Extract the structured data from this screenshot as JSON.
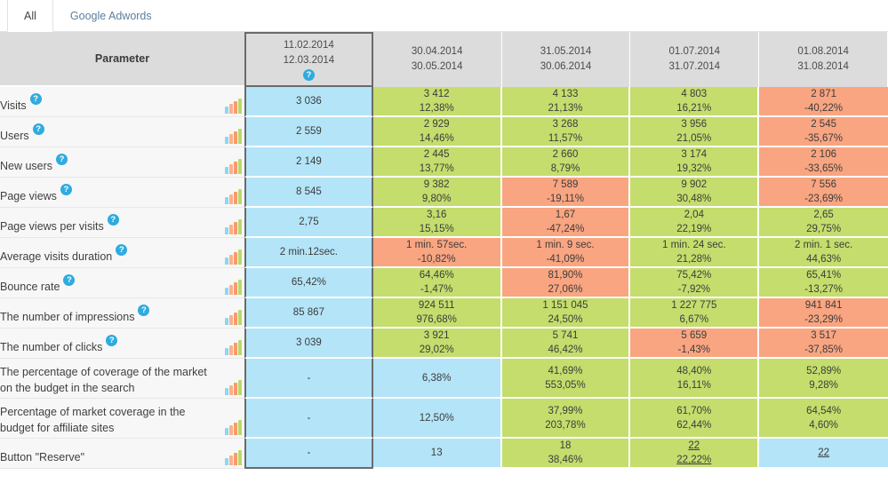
{
  "tabs": [
    {
      "label": "All",
      "active": true
    },
    {
      "label": "Google Adwords",
      "active": false
    }
  ],
  "colors": {
    "blue": "#b4e4f7",
    "green": "#c4dd6d",
    "orange": "#f9a581",
    "header_gray": "#dcdcdc",
    "badge_blue": "#2fabdf",
    "baseline_border": "#6a6a6a"
  },
  "table": {
    "param_header": "Parameter",
    "param_header_icon": "question-mark-icon",
    "columns": [
      {
        "from": "11.02.2014",
        "to": "12.03.2014",
        "baseline": true,
        "has_help": true
      },
      {
        "from": "30.04.2014",
        "to": "30.05.2014",
        "baseline": false,
        "has_help": false
      },
      {
        "from": "31.05.2014",
        "to": "30.06.2014",
        "baseline": false,
        "has_help": false
      },
      {
        "from": "01.07.2014",
        "to": "31.07.2014",
        "baseline": false,
        "has_help": false
      },
      {
        "from": "01.08.2014",
        "to": "31.08.2014",
        "baseline": false,
        "has_help": false
      }
    ],
    "rows": [
      {
        "label": "Visits",
        "has_help": true,
        "cells": [
          {
            "value": "3 036",
            "pct": "",
            "color": "blue"
          },
          {
            "value": "3 412",
            "pct": "12,38%",
            "color": "green"
          },
          {
            "value": "4 133",
            "pct": "21,13%",
            "color": "green"
          },
          {
            "value": "4 803",
            "pct": "16,21%",
            "color": "green"
          },
          {
            "value": "2 871",
            "pct": "-40,22%",
            "color": "orange"
          }
        ]
      },
      {
        "label": "Users",
        "has_help": true,
        "cells": [
          {
            "value": "2 559",
            "pct": "",
            "color": "blue"
          },
          {
            "value": "2 929",
            "pct": "14,46%",
            "color": "green"
          },
          {
            "value": "3 268",
            "pct": "11,57%",
            "color": "green"
          },
          {
            "value": "3 956",
            "pct": "21,05%",
            "color": "green"
          },
          {
            "value": "2 545",
            "pct": "-35,67%",
            "color": "orange"
          }
        ]
      },
      {
        "label": "New users",
        "has_help": true,
        "cells": [
          {
            "value": "2 149",
            "pct": "",
            "color": "blue"
          },
          {
            "value": "2 445",
            "pct": "13,77%",
            "color": "green"
          },
          {
            "value": "2 660",
            "pct": "8,79%",
            "color": "green"
          },
          {
            "value": "3 174",
            "pct": "19,32%",
            "color": "green"
          },
          {
            "value": "2 106",
            "pct": "-33,65%",
            "color": "orange"
          }
        ]
      },
      {
        "label": "Page views",
        "has_help": true,
        "cells": [
          {
            "value": "8 545",
            "pct": "",
            "color": "blue"
          },
          {
            "value": "9 382",
            "pct": "9,80%",
            "color": "green"
          },
          {
            "value": "7 589",
            "pct": "-19,11%",
            "color": "orange"
          },
          {
            "value": "9 902",
            "pct": "30,48%",
            "color": "green"
          },
          {
            "value": "7 556",
            "pct": "-23,69%",
            "color": "orange"
          }
        ]
      },
      {
        "label": "Page views per visits",
        "has_help": true,
        "cells": [
          {
            "value": "2,75",
            "pct": "",
            "color": "blue"
          },
          {
            "value": "3,16",
            "pct": "15,15%",
            "color": "green"
          },
          {
            "value": "1,67",
            "pct": "-47,24%",
            "color": "orange"
          },
          {
            "value": "2,04",
            "pct": "22,19%",
            "color": "green"
          },
          {
            "value": "2,65",
            "pct": "29,75%",
            "color": "green"
          }
        ]
      },
      {
        "label": "Average visits duration",
        "has_help": true,
        "cells": [
          {
            "value": "2 min.12sec.",
            "pct": "",
            "color": "blue"
          },
          {
            "value": "1 min. 57sec.",
            "pct": "-10,82%",
            "color": "orange"
          },
          {
            "value": "1 min. 9 sec.",
            "pct": "-41,09%",
            "color": "orange"
          },
          {
            "value": "1 min. 24 sec.",
            "pct": "21,28%",
            "color": "green"
          },
          {
            "value": "2 min. 1 sec.",
            "pct": "44,63%",
            "color": "green"
          }
        ]
      },
      {
        "label": "Bounce rate",
        "has_help": true,
        "cells": [
          {
            "value": "65,42%",
            "pct": "",
            "color": "blue"
          },
          {
            "value": "64,46%",
            "pct": "-1,47%",
            "color": "green"
          },
          {
            "value": "81,90%",
            "pct": "27,06%",
            "color": "orange"
          },
          {
            "value": "75,42%",
            "pct": "-7,92%",
            "color": "green"
          },
          {
            "value": "65,41%",
            "pct": "-13,27%",
            "color": "green"
          }
        ]
      },
      {
        "label": "The number of impressions",
        "has_help": true,
        "cells": [
          {
            "value": "85 867",
            "pct": "",
            "color": "blue"
          },
          {
            "value": "924 511",
            "pct": "976,68%",
            "color": "green"
          },
          {
            "value": "1 151 045",
            "pct": "24,50%",
            "color": "green"
          },
          {
            "value": "1 227 775",
            "pct": "6,67%",
            "color": "green"
          },
          {
            "value": "941 841",
            "pct": "-23,29%",
            "color": "orange"
          }
        ]
      },
      {
        "label": "The number of clicks",
        "has_help": true,
        "cells": [
          {
            "value": "3 039",
            "pct": "",
            "color": "blue"
          },
          {
            "value": "3 921",
            "pct": "29,02%",
            "color": "green"
          },
          {
            "value": "5 741",
            "pct": "46,42%",
            "color": "green"
          },
          {
            "value": "5 659",
            "pct": "-1,43%",
            "color": "orange"
          },
          {
            "value": "3 517",
            "pct": "-37,85%",
            "color": "orange"
          }
        ]
      },
      {
        "label": "The percentage of coverage of the market on the budget in the search",
        "has_help": false,
        "cells": [
          {
            "value": "-",
            "pct": "",
            "color": "blue"
          },
          {
            "value": "6,38%",
            "pct": "",
            "color": "blue"
          },
          {
            "value": "41,69%",
            "pct": "553,05%",
            "color": "green"
          },
          {
            "value": "48,40%",
            "pct": "16,11%",
            "color": "green"
          },
          {
            "value": "52,89%",
            "pct": "9,28%",
            "color": "green"
          }
        ]
      },
      {
        "label": "Percentage of market coverage in the budget for affiliate sites",
        "has_help": false,
        "cells": [
          {
            "value": "-",
            "pct": "",
            "color": "blue"
          },
          {
            "value": "12,50%",
            "pct": "",
            "color": "blue"
          },
          {
            "value": "37,99%",
            "pct": "203,78%",
            "color": "green"
          },
          {
            "value": "61,70%",
            "pct": "62,44%",
            "color": "green"
          },
          {
            "value": "64,54%",
            "pct": "4,60%",
            "color": "green"
          }
        ]
      },
      {
        "label": "Button \"Reserve\"",
        "has_help": false,
        "cells": [
          {
            "value": "-",
            "pct": "",
            "color": "blue"
          },
          {
            "value": "13",
            "pct": "",
            "color": "blue"
          },
          {
            "value": "18",
            "pct": "38,46%",
            "color": "green"
          },
          {
            "value": "22",
            "pct": "22,22%",
            "color": "green",
            "link": true
          },
          {
            "value": "22",
            "pct": "",
            "color": "blue",
            "link": true
          }
        ]
      }
    ]
  },
  "chart_data": {
    "type": "table",
    "title": "Web analytics parameters by date range",
    "categories": [
      "11.02.2014 - 12.03.2014",
      "30.04.2014 - 30.05.2014",
      "31.05.2014 - 30.06.2014",
      "01.07.2014 - 31.07.2014",
      "01.08.2014 - 31.08.2014"
    ],
    "series": [
      {
        "name": "Visits",
        "values": [
          "3 036",
          "3 412",
          "4 133",
          "4 803",
          "2 871"
        ],
        "pct": [
          "",
          "12,38%",
          "21,13%",
          "16,21%",
          "-40,22%"
        ]
      },
      {
        "name": "Users",
        "values": [
          "2 559",
          "2 929",
          "3 268",
          "3 956",
          "2 545"
        ],
        "pct": [
          "",
          "14,46%",
          "11,57%",
          "21,05%",
          "-35,67%"
        ]
      },
      {
        "name": "New users",
        "values": [
          "2 149",
          "2 445",
          "2 660",
          "3 174",
          "2 106"
        ],
        "pct": [
          "",
          "13,77%",
          "8,79%",
          "19,32%",
          "-33,65%"
        ]
      },
      {
        "name": "Page views",
        "values": [
          "8 545",
          "9 382",
          "7 589",
          "9 902",
          "7 556"
        ],
        "pct": [
          "",
          "9,80%",
          "-19,11%",
          "30,48%",
          "-23,69%"
        ]
      },
      {
        "name": "Page views per visits",
        "values": [
          "2,75",
          "3,16",
          "1,67",
          "2,04",
          "2,65"
        ],
        "pct": [
          "",
          "15,15%",
          "-47,24%",
          "22,19%",
          "29,75%"
        ]
      },
      {
        "name": "Average visits duration",
        "values": [
          "2 min.12sec.",
          "1 min. 57sec.",
          "1 min. 9 sec.",
          "1 min. 24 sec.",
          "2 min. 1 sec."
        ],
        "pct": [
          "",
          "-10,82%",
          "-41,09%",
          "21,28%",
          "44,63%"
        ]
      },
      {
        "name": "Bounce rate",
        "values": [
          "65,42%",
          "64,46%",
          "81,90%",
          "75,42%",
          "65,41%"
        ],
        "pct": [
          "",
          "-1,47%",
          "27,06%",
          "-7,92%",
          "-13,27%"
        ]
      },
      {
        "name": "The number of impressions",
        "values": [
          "85 867",
          "924 511",
          "1 151 045",
          "1 227 775",
          "941 841"
        ],
        "pct": [
          "",
          "976,68%",
          "24,50%",
          "6,67%",
          "-23,29%"
        ]
      },
      {
        "name": "The number of clicks",
        "values": [
          "3 039",
          "3 921",
          "5 741",
          "5 659",
          "3 517"
        ],
        "pct": [
          "",
          "29,02%",
          "46,42%",
          "-1,43%",
          "-37,85%"
        ]
      },
      {
        "name": "The percentage of coverage of the market on the budget in the search",
        "values": [
          "-",
          "6,38%",
          "41,69%",
          "48,40%",
          "52,89%"
        ],
        "pct": [
          "",
          "",
          "553,05%",
          "16,11%",
          "9,28%"
        ]
      },
      {
        "name": "Percentage of market coverage in the budget for affiliate sites",
        "values": [
          "-",
          "12,50%",
          "37,99%",
          "61,70%",
          "64,54%"
        ],
        "pct": [
          "",
          "",
          "203,78%",
          "62,44%",
          "4,60%"
        ]
      },
      {
        "name": "Button \"Reserve\"",
        "values": [
          "-",
          "13",
          "18",
          "22",
          "22"
        ],
        "pct": [
          "",
          "",
          "38,46%",
          "22,22%",
          ""
        ]
      }
    ]
  }
}
